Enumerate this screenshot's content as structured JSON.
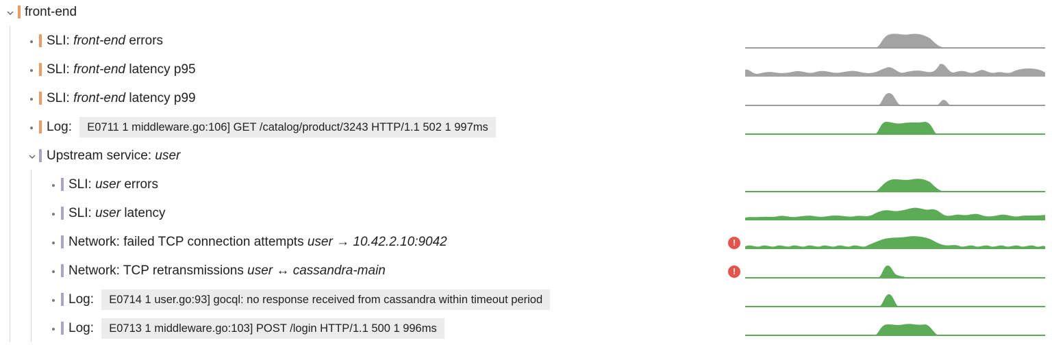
{
  "colors": {
    "frontend_accent": "#ee9a63",
    "upstream_accent": "#a9a2cf",
    "spark_gray": "#a3a3a3",
    "spark_gray_line": "#9a9a9a",
    "spark_green": "#5cab56",
    "alert": "#e8524a"
  },
  "root": {
    "label": "front-end",
    "expanded": true
  },
  "items": [
    {
      "prefix": "SLI: ",
      "em": "front-end",
      "suffix": " errors",
      "spark": "gray"
    },
    {
      "prefix": "SLI: ",
      "em": "front-end",
      "suffix": " latency p95",
      "spark": "gray"
    },
    {
      "prefix": "SLI: ",
      "em": "front-end",
      "suffix": " latency p99",
      "spark": "gray"
    },
    {
      "prefix": "Log: ",
      "log": "E0711 1 middleware.go:106] GET /catalog/product/3243 HTTP/1.1 502 1 997ms",
      "spark": "green"
    }
  ],
  "upstream": {
    "prefix": "Upstream service: ",
    "em": "user",
    "expanded": true,
    "items": [
      {
        "prefix": "SLI: ",
        "em": "user",
        "suffix": " errors",
        "spark": "green"
      },
      {
        "prefix": "SLI: ",
        "em": "user",
        "suffix": " latency",
        "spark": "green"
      },
      {
        "prefix": "Network: failed TCP connection attempts ",
        "em": "user",
        "mid": " → ",
        "em2": "10.42.2.10:9042",
        "alert": "!",
        "spark": "green"
      },
      {
        "prefix": "Network: TCP retransmissions ",
        "em": "user",
        "mid": " ↔ ",
        "em2": "cassandra-main",
        "alert": "!",
        "spark": "green"
      },
      {
        "prefix": "Log: ",
        "log": "E0714 1 user.go:93] gocql: no response received from cassandra within timeout period",
        "spark": "green"
      },
      {
        "prefix": "Log: ",
        "log": "E0713 1 middleware.go:103] POST /login HTTP/1.1 500 1 996ms",
        "spark": "green"
      }
    ]
  }
}
